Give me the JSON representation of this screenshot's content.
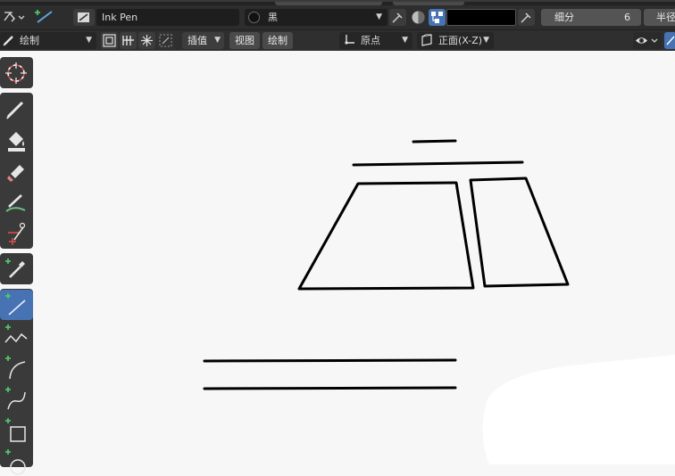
{
  "tool_header": {
    "brush_name": "Ink Pen",
    "material_name": "黑",
    "subdivision_label": "细分",
    "subdivision_value": "6",
    "radius_label_partial": "半径"
  },
  "mode_header": {
    "mode_label": "绘制",
    "interpolate_label": "插值",
    "view_menu": "视图",
    "draw_menu": "绘制",
    "origin_label": "原点",
    "plane_label": "正面(X-Z)"
  },
  "tools": [
    {
      "name": "cursor-tool-icon"
    },
    {
      "name": "draw-tool-icon"
    },
    {
      "name": "fill-tool-icon"
    },
    {
      "name": "erase-tool-icon"
    },
    {
      "name": "tint-tool-icon"
    },
    {
      "name": "cutter-tool-icon"
    },
    {
      "name": "eyedropper-tool-icon"
    },
    {
      "name": "line-tool-icon",
      "active": true
    },
    {
      "name": "polyline-tool-icon"
    },
    {
      "name": "arc-tool-icon"
    },
    {
      "name": "curve-tool-icon"
    },
    {
      "name": "box-tool-icon"
    },
    {
      "name": "circle-tool-icon"
    }
  ],
  "colors": {
    "active_tool": "#4772b3",
    "ui_dark": "#2b2b2b",
    "field_bg": "#1e1e1e",
    "canvas_bg": "#f7f7f7",
    "stroke": "#000000",
    "add_plus": "#4fc46a"
  }
}
